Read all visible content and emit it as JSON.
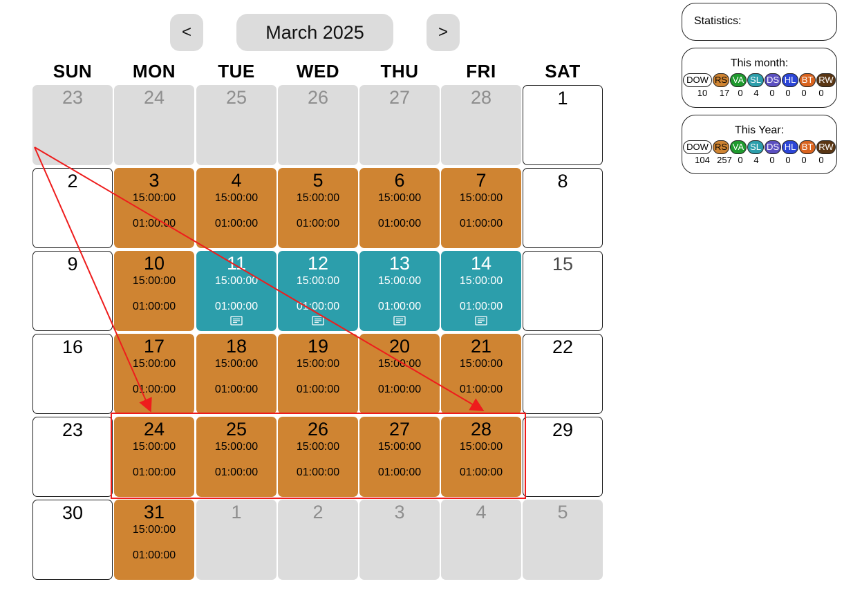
{
  "header": {
    "prev_label": "<",
    "next_label": ">",
    "month_label": "March 2025"
  },
  "weekdays": [
    "SUN",
    "MON",
    "TUE",
    "WED",
    "THU",
    "FRI",
    "SAT"
  ],
  "times": {
    "start": "15:00:00",
    "duration": "01:00:00"
  },
  "colors": {
    "orange": "#cf8432",
    "teal": "#2c9eab",
    "out_of_month": "#dcdcdc",
    "annotation": "#ee1c1c"
  },
  "weeks": [
    [
      {
        "day": "23",
        "state": "out"
      },
      {
        "day": "24",
        "state": "out"
      },
      {
        "day": "25",
        "state": "out"
      },
      {
        "day": "26",
        "state": "out"
      },
      {
        "day": "27",
        "state": "out"
      },
      {
        "day": "28",
        "state": "out"
      },
      {
        "day": "1",
        "state": "plain"
      }
    ],
    [
      {
        "day": "2",
        "state": "plain"
      },
      {
        "day": "3",
        "state": "orange"
      },
      {
        "day": "4",
        "state": "orange"
      },
      {
        "day": "5",
        "state": "orange"
      },
      {
        "day": "6",
        "state": "orange"
      },
      {
        "day": "7",
        "state": "orange"
      },
      {
        "day": "8",
        "state": "plain"
      }
    ],
    [
      {
        "day": "9",
        "state": "plain"
      },
      {
        "day": "10",
        "state": "orange"
      },
      {
        "day": "11",
        "state": "teal"
      },
      {
        "day": "12",
        "state": "teal"
      },
      {
        "day": "13",
        "state": "teal"
      },
      {
        "day": "14",
        "state": "teal"
      },
      {
        "day": "15",
        "state": "plain",
        "dim": true
      }
    ],
    [
      {
        "day": "16",
        "state": "plain"
      },
      {
        "day": "17",
        "state": "orange"
      },
      {
        "day": "18",
        "state": "orange"
      },
      {
        "day": "19",
        "state": "orange"
      },
      {
        "day": "20",
        "state": "orange"
      },
      {
        "day": "21",
        "state": "orange"
      },
      {
        "day": "22",
        "state": "plain"
      }
    ],
    [
      {
        "day": "23",
        "state": "plain"
      },
      {
        "day": "24",
        "state": "orange"
      },
      {
        "day": "25",
        "state": "orange"
      },
      {
        "day": "26",
        "state": "orange"
      },
      {
        "day": "27",
        "state": "orange"
      },
      {
        "day": "28",
        "state": "orange"
      },
      {
        "day": "29",
        "state": "plain"
      }
    ],
    [
      {
        "day": "30",
        "state": "plain"
      },
      {
        "day": "31",
        "state": "orange"
      },
      {
        "day": "1",
        "state": "out"
      },
      {
        "day": "2",
        "state": "out"
      },
      {
        "day": "3",
        "state": "out"
      },
      {
        "day": "4",
        "state": "out"
      },
      {
        "day": "5",
        "state": "out"
      }
    ]
  ],
  "statistics": {
    "title": "Statistics:",
    "badges": [
      {
        "code": "DOW",
        "color": "#ffffff",
        "text_color": "#000000"
      },
      {
        "code": "RS",
        "color": "#cf8432",
        "text_color": "#000000"
      },
      {
        "code": "VA",
        "color": "#1f9a2e",
        "text_color": "#ffffff"
      },
      {
        "code": "SL",
        "color": "#2c9eab",
        "text_color": "#ffffff"
      },
      {
        "code": "DS",
        "color": "#5b4fc0",
        "text_color": "#ffffff"
      },
      {
        "code": "HL",
        "color": "#2b45d6",
        "text_color": "#ffffff"
      },
      {
        "code": "BT",
        "color": "#d9631e",
        "text_color": "#ffffff"
      },
      {
        "code": "RW",
        "color": "#5a3614",
        "text_color": "#ffffff"
      }
    ],
    "month": {
      "label": "This month:",
      "counts": [
        "10",
        "17",
        "0",
        "4",
        "0",
        "0",
        "0",
        "0"
      ]
    },
    "year": {
      "label": "This Year:",
      "counts": [
        "104",
        "257",
        "0",
        "4",
        "0",
        "0",
        "0",
        "0"
      ]
    }
  }
}
